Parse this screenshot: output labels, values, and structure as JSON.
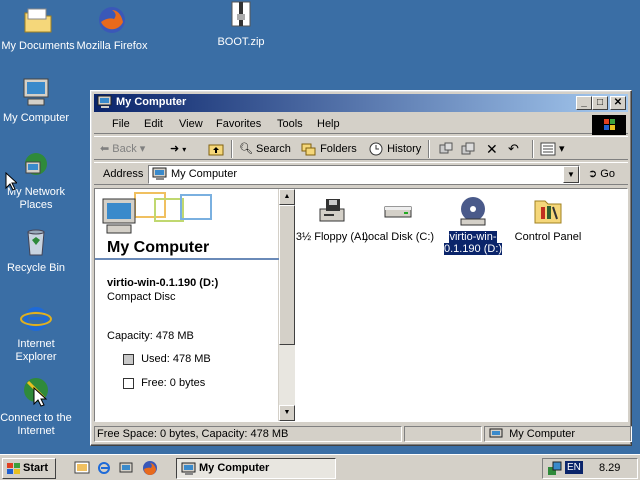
{
  "desktop": {
    "icons": [
      {
        "label": "My Documents"
      },
      {
        "label": "Mozilla Firefox"
      },
      {
        "label": "BOOT.zip"
      },
      {
        "label": "My Computer"
      },
      {
        "label": "My Network Places"
      },
      {
        "label": "Recycle Bin"
      },
      {
        "label": "Internet Explorer"
      },
      {
        "label": "Connect to the Internet"
      }
    ]
  },
  "window": {
    "title": "My Computer",
    "menu": [
      "File",
      "Edit",
      "View",
      "Favorites",
      "Tools",
      "Help"
    ],
    "toolbar": {
      "back": "Back",
      "search": "Search",
      "folders": "Folders",
      "history": "History"
    },
    "address": {
      "label": "Address",
      "value": "My Computer",
      "go": "Go"
    },
    "left_pane": {
      "heading": "My Computer",
      "selected_name": "virtio-win-0.1.190 (D:)",
      "selected_type": "Compact Disc",
      "capacity": "Capacity: 478 MB",
      "used": "Used: 478 MB",
      "free": "Free: 0 bytes"
    },
    "items": [
      {
        "label": "3½ Floppy (A:)"
      },
      {
        "label": "Local Disk (C:)"
      },
      {
        "label": "virtio-win-0.1.190 (D:)"
      },
      {
        "label": "Control Panel"
      }
    ],
    "status": {
      "left": "Free Space: 0 bytes, Capacity: 478 MB",
      "right": "My Computer"
    }
  },
  "taskbar": {
    "start": "Start",
    "task": "My Computer",
    "lang": "EN",
    "clock": "8.29"
  }
}
